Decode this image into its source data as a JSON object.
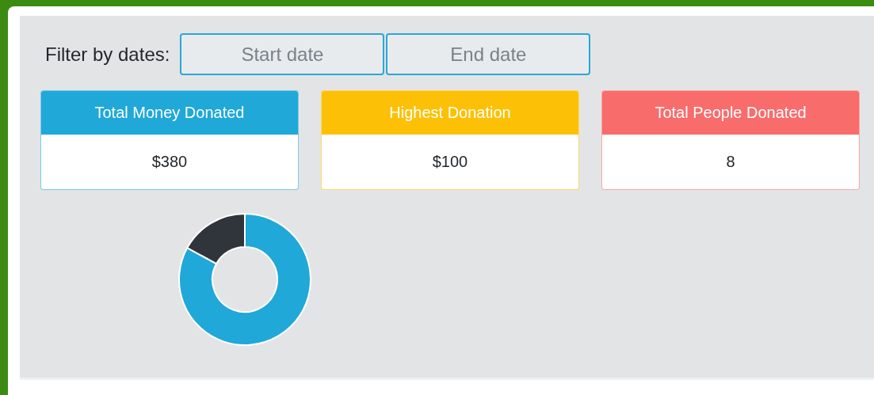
{
  "filter": {
    "label": "Filter by dates:",
    "fields": [
      {
        "placeholder": "Start date"
      },
      {
        "placeholder": "End date"
      }
    ]
  },
  "cards": [
    {
      "title": "Total Money Donated",
      "value": "$380",
      "color": "#20a8d8"
    },
    {
      "title": "Highest Donation",
      "value": "$100",
      "color": "#fcc107"
    },
    {
      "title": "Total People Donated",
      "value": "8",
      "color": "#f86c6b"
    }
  ]
}
